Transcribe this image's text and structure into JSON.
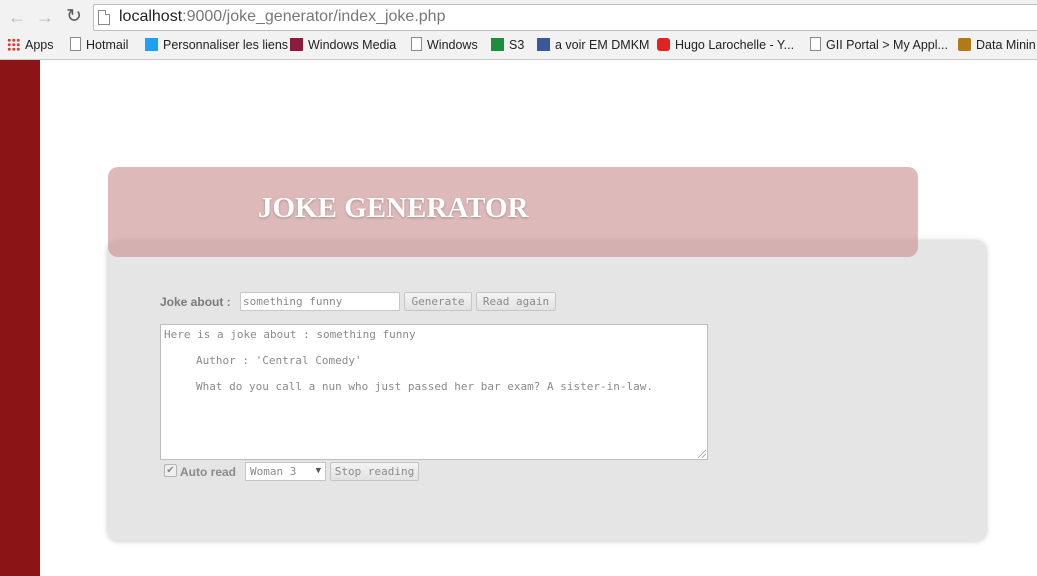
{
  "browser": {
    "url_host": "localhost",
    "url_rest": ":9000/joke_generator/index_joke.php",
    "bookmarks": [
      {
        "label": "Apps",
        "icon": "apps-icon"
      },
      {
        "label": "Hotmail",
        "icon": "page-icon"
      },
      {
        "label": "Personnaliser les liens",
        "icon": "windows-icon"
      },
      {
        "label": "Windows Media",
        "icon": "windows-media-icon"
      },
      {
        "label": "Windows",
        "icon": "page-icon"
      },
      {
        "label": "S3",
        "icon": "sheets-icon"
      },
      {
        "label": "a voir EM DMKM",
        "icon": "facebook-icon"
      },
      {
        "label": "Hugo Larochelle - Y...",
        "icon": "youtube-icon"
      },
      {
        "label": "GII Portal > My Appl...",
        "icon": "page-icon"
      },
      {
        "label": "Data Minin",
        "icon": "datamining-icon"
      }
    ]
  },
  "header": {
    "title": "JOKE GENERATOR"
  },
  "form": {
    "joke_about_label": "Joke about :",
    "joke_about_value": "something funny",
    "generate_label": "Generate",
    "read_again_label": "Read again"
  },
  "output": {
    "line1": "Here is a joke about : something funny",
    "line2": "Author : 'Central Comedy'",
    "line3": "What do you call a nun who just passed her bar exam? A sister-in-law."
  },
  "controls": {
    "auto_read_checked": true,
    "auto_read_label": "Auto read",
    "voice_selected": "Woman 3",
    "stop_label": "Stop reading"
  },
  "colors": {
    "left_bar": "#8b1416",
    "banner": "#cb9494",
    "panel": "#e5e5e5"
  }
}
